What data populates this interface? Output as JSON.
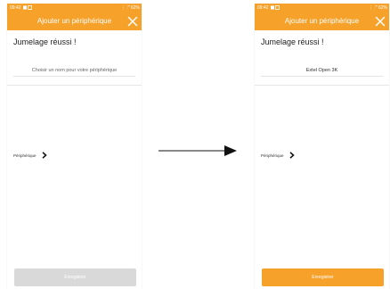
{
  "status_bar": {
    "time": "09:42",
    "right": "⋮ .‴ 62%"
  },
  "header": {
    "title": "Ajouter un périphérique"
  },
  "before": {
    "success_title": "Jumelage réussi !",
    "name_placeholder": "Choisir un nom pour votre périphérique",
    "device_label": "Périphérique",
    "save_label": "Enregistrer",
    "save_state": "disabled"
  },
  "after": {
    "success_title": "Jumelage réussi !",
    "name_value": "Extel Open 3K",
    "device_label": "Périphérique",
    "save_label": "Enregistrer",
    "save_state": "enabled"
  },
  "colors": {
    "accent": "#f5a12a",
    "disabled": "#d9d9d9",
    "text": "#222222"
  }
}
